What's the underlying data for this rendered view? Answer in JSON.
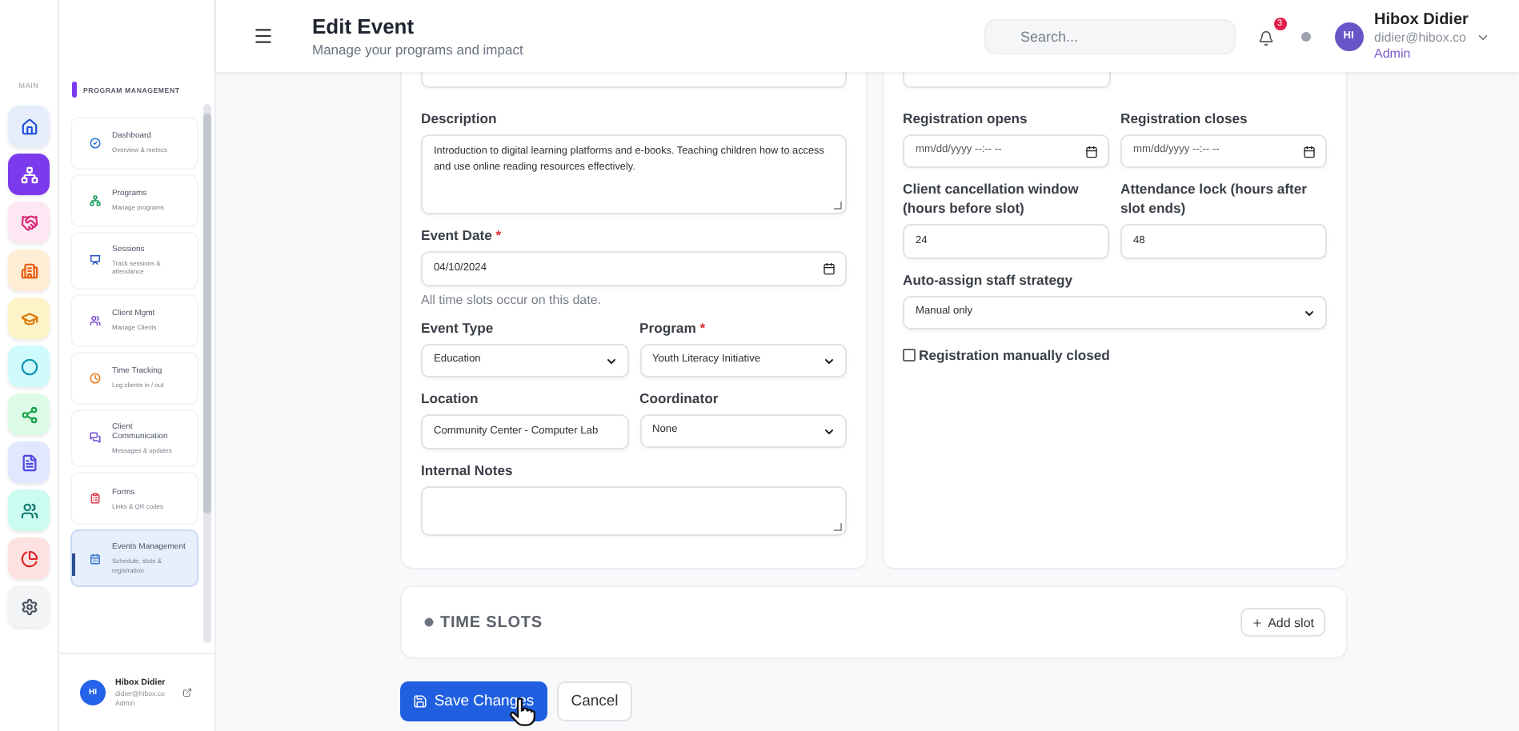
{
  "rail": {
    "label": "MAIN",
    "items": [
      {
        "kind": "home",
        "selected": false,
        "color": "#1d4ed8"
      },
      {
        "kind": "network",
        "selected": true,
        "color": "#ffffff"
      },
      {
        "kind": "handshake",
        "selected": false,
        "color": "#db2777"
      },
      {
        "kind": "building",
        "selected": false,
        "color": "#ea580c"
      },
      {
        "kind": "graduation",
        "selected": false,
        "color": "#d97706"
      },
      {
        "kind": "globe",
        "selected": false,
        "color": "#0891b2"
      },
      {
        "kind": "share",
        "selected": false,
        "color": "#16a34a"
      },
      {
        "kind": "report",
        "selected": false,
        "color": "#4f46e5"
      },
      {
        "kind": "team",
        "selected": false,
        "color": "#0f766e"
      },
      {
        "kind": "chart",
        "selected": false,
        "color": "#dc2626"
      },
      {
        "kind": "settings",
        "selected": false,
        "color": "#4b5563"
      }
    ]
  },
  "sidebar": {
    "heading": "PROGRAM MANAGEMENT",
    "items": [
      {
        "kind": "dashboard",
        "title": "Dashboard",
        "subtitle": "Overview & metrics",
        "selected": false,
        "color": "#2f6fd6"
      },
      {
        "kind": "programs",
        "title": "Programs",
        "subtitle": "Manage programs",
        "selected": false,
        "color": "#169c5a"
      },
      {
        "kind": "sessions",
        "title": "Sessions",
        "subtitle": "Track sessions & attendance",
        "selected": false,
        "color": "#2856c6"
      },
      {
        "kind": "clients",
        "title": "Client Mgmt",
        "subtitle": "Manage Clients",
        "selected": false,
        "color": "#7c4fd0"
      },
      {
        "kind": "time",
        "title": "Time Tracking",
        "subtitle": "Log clients in / out",
        "selected": false,
        "color": "#ea7a12"
      },
      {
        "kind": "communication",
        "title": "Client Communication",
        "subtitle": "Messages & updates",
        "selected": false,
        "color": "#6d4bd1"
      },
      {
        "kind": "forms",
        "title": "Forms",
        "subtitle": "Links & QR codes",
        "selected": false,
        "color": "#d93a4a"
      },
      {
        "kind": "events",
        "title": "Events Management",
        "subtitle": "Schedule, slots & registration",
        "selected": true,
        "color": "#3a78d0"
      }
    ],
    "user": {
      "initials": "HI",
      "name": "Hibox Didier",
      "email": "didier@hibox.co",
      "role": "Admin"
    }
  },
  "header": {
    "title": "Edit Event",
    "subtitle": "Manage your programs and impact",
    "search": {
      "placeholder": "Search..."
    },
    "notification_count": "3",
    "user": {
      "initials": "HI",
      "name": "Hibox Didier",
      "email": "didier@hibox.co",
      "role": "Admin"
    }
  },
  "form": {
    "left": [
      [
        {
          "kind": "textarea",
          "label": "Description",
          "value": "Introduction to digital learning platforms and e-books. Teaching children how to access and use online reading resources effectively."
        }
      ],
      [
        {
          "kind": "date",
          "label": "Event Date",
          "required_mark": "*",
          "value": "04/10/2024",
          "hint": "All time slots occur on this date."
        }
      ],
      [
        {
          "kind": "select",
          "label": "Event Type",
          "value": "Education"
        },
        {
          "kind": "select",
          "label": "Program",
          "required_mark": "*",
          "value": "Youth Literacy Initiative"
        }
      ],
      [
        {
          "kind": "text",
          "label": "Location",
          "value": "Community Center - Computer Lab"
        },
        {
          "kind": "select",
          "label": "Coordinator",
          "value": "None"
        }
      ],
      [
        {
          "kind": "notes",
          "label": "Internal Notes"
        }
      ]
    ],
    "right": [
      [
        {
          "kind": "datetime",
          "label": "Registration opens",
          "placeholder": "mm/dd/yyyy --:-- --"
        },
        {
          "kind": "datetime",
          "label": "Registration closes",
          "placeholder": "mm/dd/yyyy --:-- --"
        }
      ],
      [
        {
          "kind": "text",
          "label": "Client cancellation window (hours before slot)",
          "value": "24"
        },
        {
          "kind": "text",
          "label": "Attendance lock (hours after slot ends)",
          "value": "48"
        }
      ],
      [
        {
          "kind": "select",
          "label": "Auto-assign staff strategy",
          "value": "Manual only"
        }
      ],
      [
        {
          "kind": "checkbox",
          "label": "Registration manually closed",
          "checked": false
        }
      ]
    ]
  },
  "time_slots": {
    "title": "TIME SLOTS",
    "add_button": "Add slot"
  },
  "actions": {
    "save": "Save Changes",
    "cancel": "Cancel"
  }
}
